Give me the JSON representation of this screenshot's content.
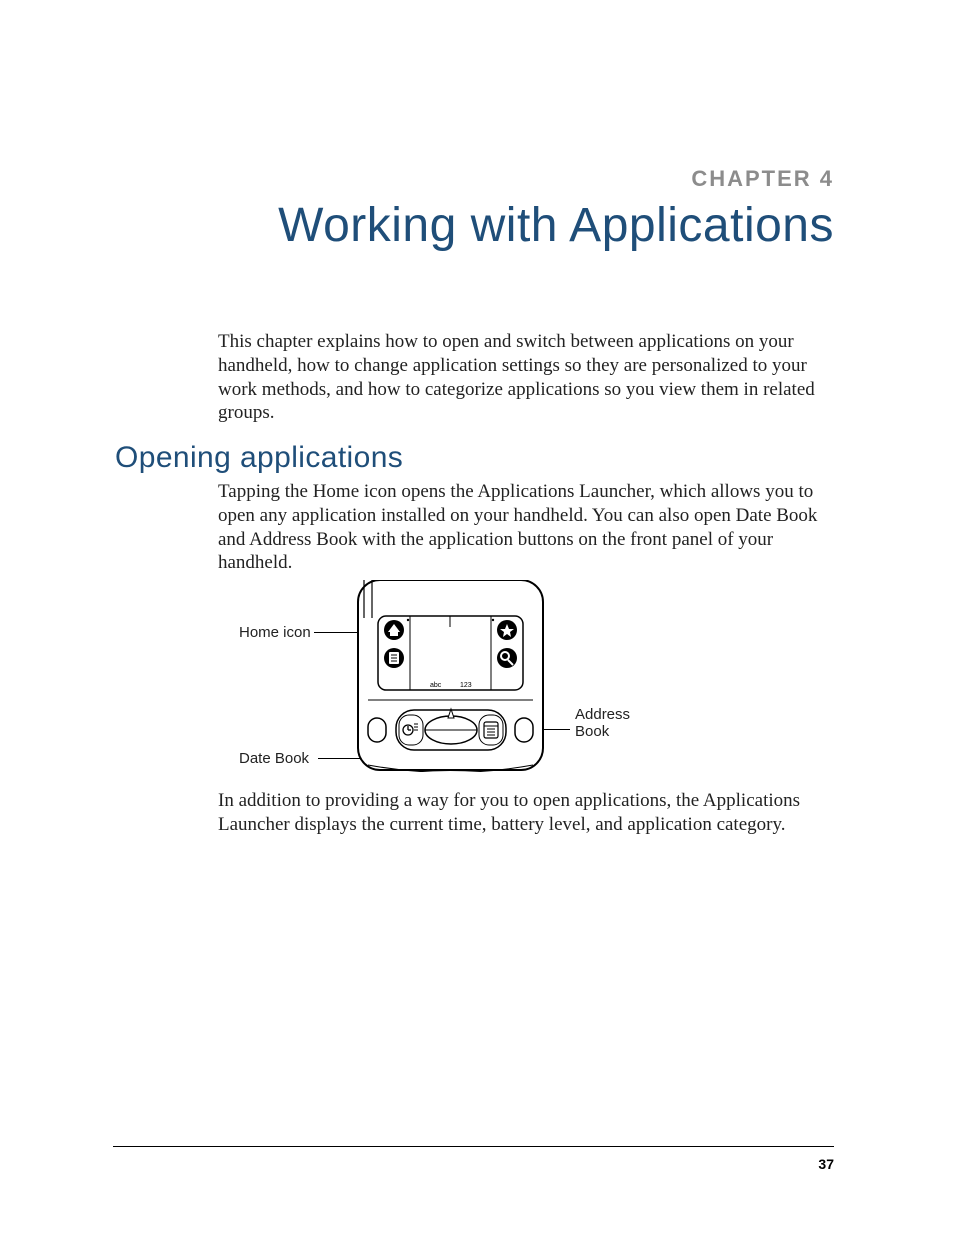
{
  "chapter_label": "CHAPTER 4",
  "chapter_title": "Working with Applications",
  "intro": "This chapter explains how to open and switch between applications on your handheld, how to change application settings so they are personalized to your work methods, and how to categorize applications so you view them in related groups.",
  "section_heading": "Opening applications",
  "section_para": "Tapping the Home icon opens the Applications Launcher, which allows you to open any application installed on your handheld. You can also open Date Book and Address Book with the application buttons on the front panel of your handheld.",
  "closing_para": "In addition to providing a way for you to open applications, the Applications Launcher displays the current time, battery level, and application category.",
  "callouts": {
    "home_icon": "Home icon",
    "date_book": "Date Book",
    "address_book": "Address Book"
  },
  "diagram_graffiti_labels": {
    "left": "abc",
    "right": "123"
  },
  "page_number": "37"
}
